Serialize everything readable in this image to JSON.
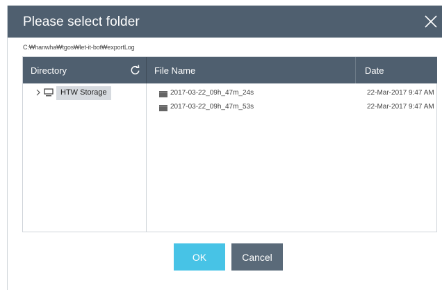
{
  "dialog": {
    "title": "Please select folder",
    "path": "C:₩hanwha₩tgos₩let-it-bot₩exportLog"
  },
  "headers": {
    "directory": "Directory",
    "file_name": "File Name",
    "date": "Date"
  },
  "tree": {
    "root_label": "HTW Storage"
  },
  "files": [
    {
      "name": "2017-03-22_09h_47m_24s",
      "date": "22-Mar-2017 9:47 AM"
    },
    {
      "name": "2017-03-22_09h_47m_53s",
      "date": "22-Mar-2017 9:47 AM"
    }
  ],
  "buttons": {
    "ok": "OK",
    "cancel": "Cancel"
  },
  "icons": {
    "close": "close-icon",
    "refresh": "refresh-icon",
    "expand": "chevron-right-icon",
    "computer": "computer-icon",
    "folder": "folder-icon"
  },
  "colors": {
    "header_bg": "#4f5f6f",
    "ok_button": "#47c3e6",
    "cancel_button": "#5a6a79",
    "selected_node": "#d6dadf"
  }
}
